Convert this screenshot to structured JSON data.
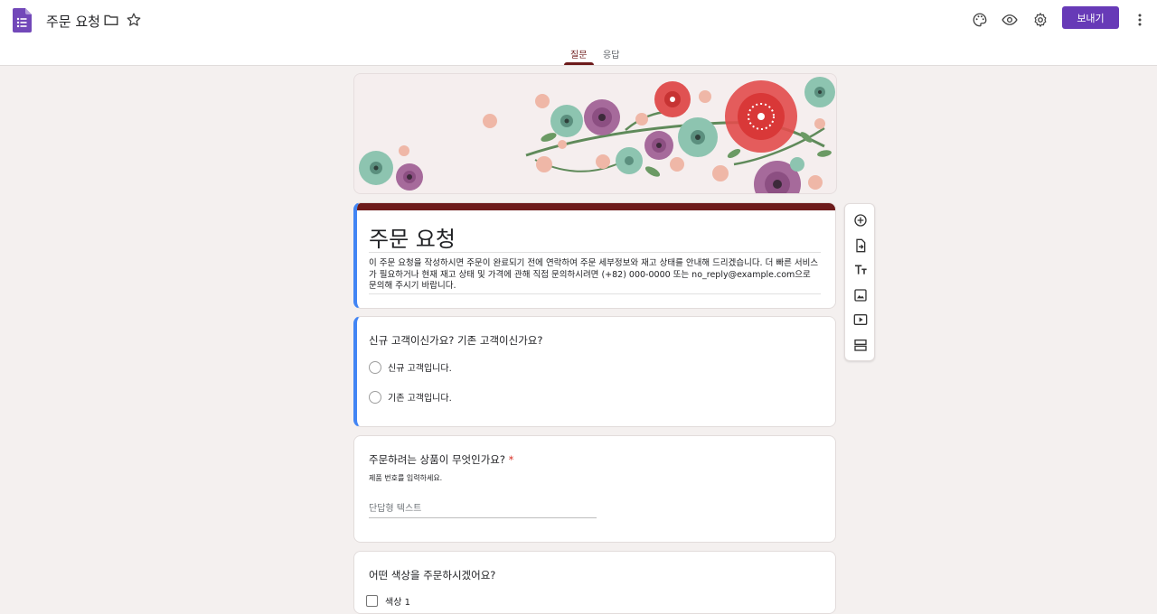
{
  "header": {
    "doc_title": "주문 요청",
    "send_label": "보내기",
    "icons": [
      "forms-logo-icon",
      "folder-icon",
      "star-icon",
      "palette-icon",
      "eye-icon",
      "gear-icon",
      "more-vert-icon"
    ],
    "accent_color": "#673ab7"
  },
  "tabs": [
    {
      "label": "질문",
      "active": true
    },
    {
      "label": "응답",
      "active": false
    }
  ],
  "theme": {
    "band_color": "#6d1b1b",
    "background": "#f4f0ef",
    "selected_border": "#4285f4"
  },
  "form": {
    "title": "주문 요청",
    "description": "이 주문 요청을 작성하시면 주문이 완료되기 전에 연락하여 주문 세부정보와 재고 상태를 안내해 드리겠습니다. 더 빠른 서비스가 필요하거나 현재 재고 상태 및 가격에 관해 직접 문의하시려면 (+82) 000-0000 또는 no_reply@example.com으로 문의해 주시기 바랍니다."
  },
  "questions": [
    {
      "title": "신규 고객이신가요? 기존 고객이신가요?",
      "options": [
        "신규 고객입니다.",
        "기존 고객입니다."
      ]
    },
    {
      "title": "주문하려는 상품이 무엇인가요?",
      "required_mark": "*",
      "help": "제품 번호를 입력하세요.",
      "placeholder": "단답형 텍스트"
    },
    {
      "title": "어떤 색상을 주문하시겠어요?",
      "options": [
        "색상 1"
      ]
    }
  ],
  "toolbar": {
    "icons": [
      "add-question-icon",
      "import-questions-icon",
      "add-title-icon",
      "add-image-icon",
      "add-video-icon",
      "add-section-icon"
    ]
  }
}
